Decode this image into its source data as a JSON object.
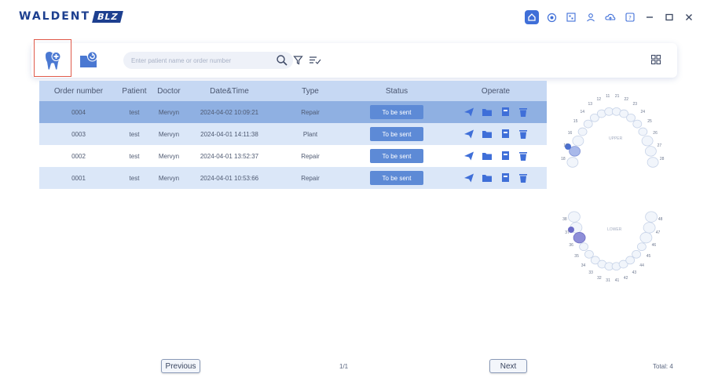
{
  "app": {
    "brand_text": "WALDENT",
    "brand_badge": "BLZ"
  },
  "window_icons": [
    "home-icon",
    "target-icon",
    "qr-icon",
    "user-icon",
    "cloud-icon",
    "help-icon",
    "minimize-icon",
    "maximize-icon",
    "close-icon"
  ],
  "toolbar": {
    "search_placeholder": "Enter patient name or order number"
  },
  "table": {
    "headers": {
      "order": "Order number",
      "patient": "Patient",
      "doctor": "Doctor",
      "datetime": "Date&Time",
      "type": "Type",
      "status": "Status",
      "operate": "Operate"
    },
    "rows": [
      {
        "order": "0004",
        "patient": "test",
        "doctor": "Mervyn",
        "datetime": "2024-04-02 10:09:21",
        "type": "Repair",
        "status": "To be sent"
      },
      {
        "order": "0003",
        "patient": "test",
        "doctor": "Mervyn",
        "datetime": "2024-04-01 14:11:38",
        "type": "Plant",
        "status": "To be sent"
      },
      {
        "order": "0002",
        "patient": "test",
        "doctor": "Mervyn",
        "datetime": "2024-04-01 13:52:37",
        "type": "Repair",
        "status": "To be sent"
      },
      {
        "order": "0001",
        "patient": "test",
        "doctor": "Mervyn",
        "datetime": "2024-04-01 10:53:66",
        "type": "Repair",
        "status": "To be sent"
      }
    ]
  },
  "tooth_chart": {
    "upper_label": "UPPER",
    "lower_label": "LOWER",
    "upper_numbers": [
      "11",
      "12",
      "13",
      "14",
      "15",
      "16",
      "17",
      "18",
      "21",
      "22",
      "23",
      "24",
      "25",
      "26",
      "27",
      "28"
    ],
    "lower_numbers": [
      "31",
      "32",
      "33",
      "34",
      "35",
      "36",
      "37",
      "38",
      "41",
      "42",
      "43",
      "44",
      "45",
      "46",
      "47",
      "48"
    ]
  },
  "pagination": {
    "previous": "Previous",
    "next": "Next",
    "page": "1/1",
    "total": "Total: 4"
  },
  "colors": {
    "accent": "#3f6fd8",
    "selected_row": "#8fb0e2",
    "status_button": "#5d8ad6",
    "highlight_box": "#e05a4a"
  }
}
